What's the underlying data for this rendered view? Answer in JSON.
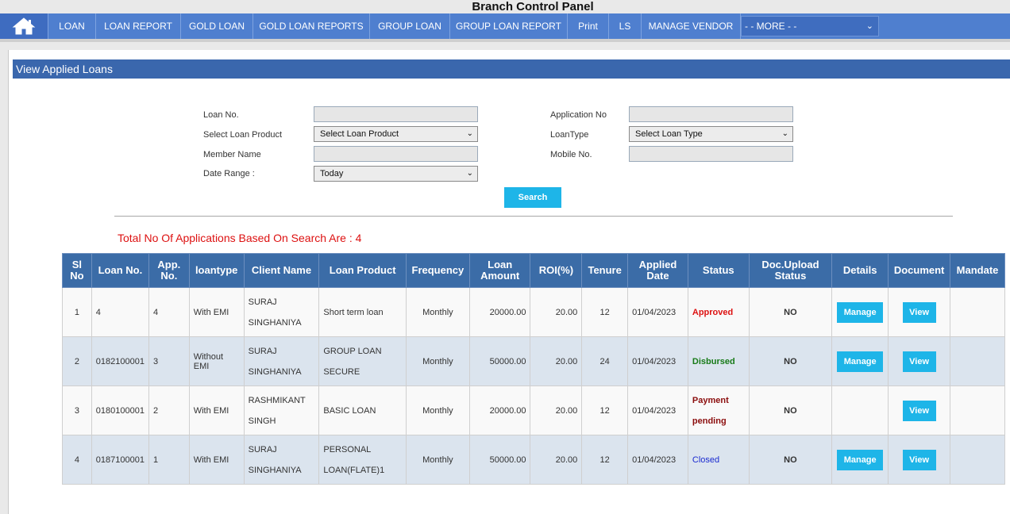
{
  "header": {
    "title": "Branch Control Panel"
  },
  "nav": {
    "items": [
      "LOAN",
      "LOAN REPORT",
      "GOLD LOAN",
      "GOLD LOAN REPORTS",
      "GROUP LOAN",
      "GROUP LOAN REPORT",
      "Print",
      "LS",
      "MANAGE VENDOR"
    ],
    "more": "- - MORE - -"
  },
  "section": {
    "title": "View Applied Loans"
  },
  "form": {
    "loan_no_label": "Loan No.",
    "loan_product_label": "Select Loan Product",
    "loan_product_value": "Select Loan Product",
    "member_name_label": "Member Name",
    "date_range_label": "Date Range :",
    "date_range_value": "Today",
    "application_no_label": "Application No",
    "loan_type_label": "LoanType",
    "loan_type_value": "Select Loan Type",
    "mobile_label": "Mobile No.",
    "search_label": "Search"
  },
  "summary": {
    "text": "Total No Of Applications Based On Search Are : 4"
  },
  "table": {
    "headers": {
      "sl_no": [
        "Sl",
        "No"
      ],
      "loan_no": "Loan No.",
      "app_no": [
        "App.",
        "No."
      ],
      "loantype": "loantype",
      "client_name": "Client Name",
      "loan_product": "Loan Product",
      "frequency": "Frequency",
      "loan_amount": [
        "Loan",
        "Amount"
      ],
      "roi": "ROI(%)",
      "tenure": "Tenure",
      "applied_date": [
        "Applied",
        "Date"
      ],
      "status": "Status",
      "doc_upload": [
        "Doc.Upload",
        "Status"
      ],
      "details": "Details",
      "document": "Document",
      "mandate": "Mandate"
    },
    "rows": [
      {
        "sl": "1",
        "loan_no": "4",
        "app_no": "4",
        "loantype": "With EMI",
        "client": [
          "SURAJ",
          "SINGHANIYA"
        ],
        "product": [
          "Short term loan"
        ],
        "frequency": "Monthly",
        "amount": "20000.00",
        "roi": "20.00",
        "tenure": "12",
        "date": "01/04/2023",
        "status": [
          "Approved"
        ],
        "doc": "NO",
        "manage": "Manage",
        "view": "View"
      },
      {
        "sl": "2",
        "loan_no": "0182100001",
        "app_no": "3",
        "loantype": "Without EMI",
        "client": [
          "SURAJ",
          "SINGHANIYA"
        ],
        "product": [
          "GROUP LOAN",
          "SECURE"
        ],
        "frequency": "Monthly",
        "amount": "50000.00",
        "roi": "20.00",
        "tenure": "24",
        "date": "01/04/2023",
        "status": [
          "Disbursed"
        ],
        "doc": "NO",
        "manage": "Manage",
        "view": "View"
      },
      {
        "sl": "3",
        "loan_no": "0180100001",
        "app_no": "2",
        "loantype": "With EMI",
        "client": [
          "RASHMIKANT",
          "SINGH"
        ],
        "product": [
          "BASIC LOAN"
        ],
        "frequency": "Monthly",
        "amount": "20000.00",
        "roi": "20.00",
        "tenure": "12",
        "date": "01/04/2023",
        "status": [
          "Payment",
          "pending"
        ],
        "doc": "NO",
        "manage": "",
        "view": "View"
      },
      {
        "sl": "4",
        "loan_no": "0187100001",
        "app_no": "1",
        "loantype": "With EMI",
        "client": [
          "SURAJ",
          "SINGHANIYA"
        ],
        "product": [
          "PERSONAL",
          "LOAN(FLATE)1"
        ],
        "frequency": "Monthly",
        "amount": "50000.00",
        "roi": "20.00",
        "tenure": "12",
        "date": "01/04/2023",
        "status": [
          "Closed"
        ],
        "doc": "NO",
        "manage": "Manage",
        "view": "View"
      }
    ]
  }
}
